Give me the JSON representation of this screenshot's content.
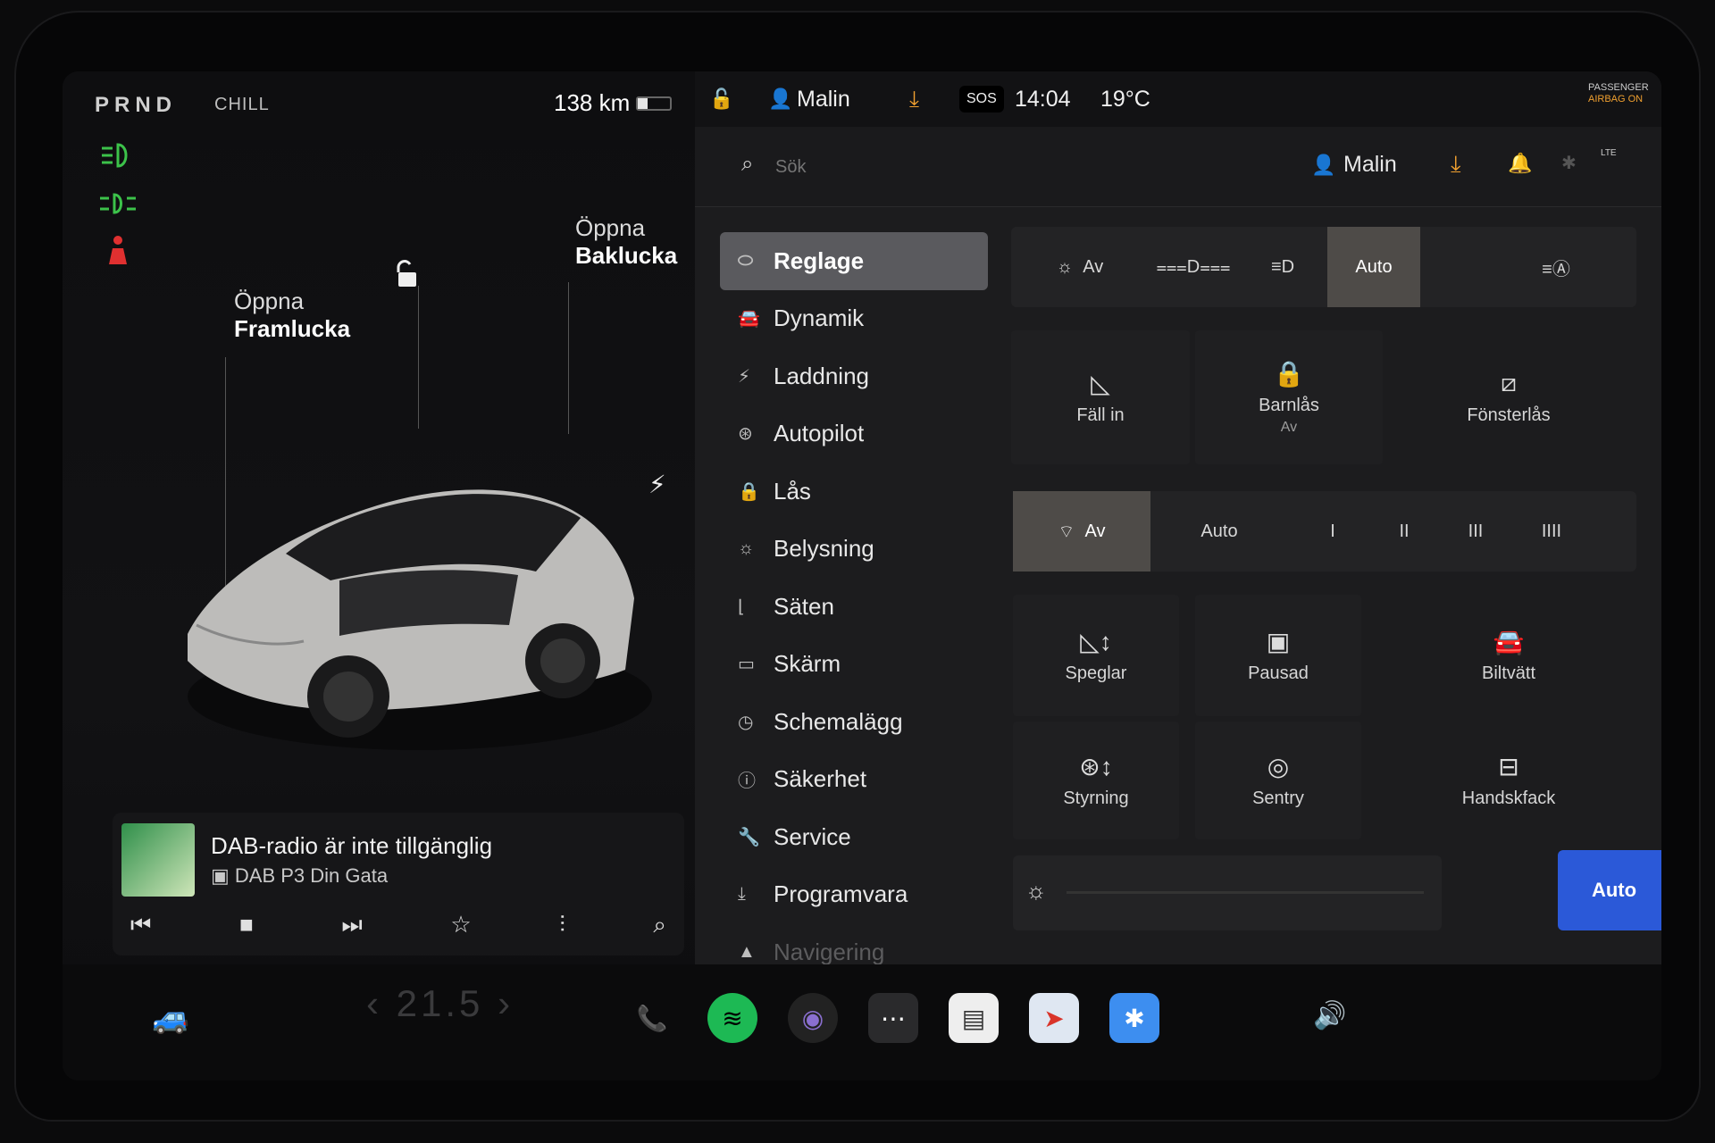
{
  "drive": {
    "gears": "PRND",
    "mode": "CHILL",
    "range": "138 km"
  },
  "car": {
    "frunk_label_top": "Öppna",
    "frunk_label_bottom": "Framlucka",
    "trunk_label_top": "Öppna",
    "trunk_label_bottom": "Baklucka"
  },
  "media": {
    "title": "DAB-radio är inte tillgänglig",
    "station": "DAB P3 Din Gata"
  },
  "status": {
    "user": "Malin",
    "time": "14:04",
    "temp": "19°C",
    "sos": "SOS",
    "airbag_line1": "PASSENGER",
    "airbag_line2": "AIRBAG ON"
  },
  "search": {
    "placeholder": "Sök",
    "user": "Malin",
    "lte": "LTE"
  },
  "nav": {
    "items": [
      {
        "label": "Reglage",
        "icon": "toggle-icon"
      },
      {
        "label": "Dynamik",
        "icon": "car-icon"
      },
      {
        "label": "Laddning",
        "icon": "bolt-icon"
      },
      {
        "label": "Autopilot",
        "icon": "steering-icon"
      },
      {
        "label": "Lås",
        "icon": "lock-icon"
      },
      {
        "label": "Belysning",
        "icon": "sun-icon"
      },
      {
        "label": "Säten",
        "icon": "seat-icon"
      },
      {
        "label": "Skärm",
        "icon": "display-icon"
      },
      {
        "label": "Schemalägg",
        "icon": "clock-icon"
      },
      {
        "label": "Säkerhet",
        "icon": "info-icon"
      },
      {
        "label": "Service",
        "icon": "wrench-icon"
      },
      {
        "label": "Programvara",
        "icon": "download-icon"
      },
      {
        "label": "Navigering",
        "icon": "nav-icon"
      }
    ]
  },
  "lights": {
    "off": "Av",
    "auto": "Auto"
  },
  "tiles": {
    "fold": "Fäll in",
    "childlock": "Barnlås",
    "childlock_sub": "Av",
    "windowlock": "Fönsterlås",
    "mirrors": "Speglar",
    "paused": "Pausad",
    "carwash": "Biltvätt",
    "steering": "Styrning",
    "sentry": "Sentry",
    "glovebox": "Handskfack"
  },
  "wipers": {
    "off": "Av",
    "auto": "Auto",
    "levels": [
      "I",
      "II",
      "III",
      "IIII"
    ]
  },
  "brightness": {
    "auto": "Auto"
  },
  "dock": {
    "temp": "21.5"
  }
}
